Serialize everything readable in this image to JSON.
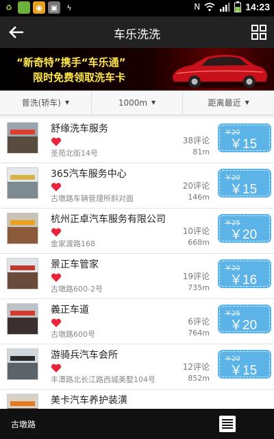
{
  "status_bar": {
    "time": "14:23",
    "icons": [
      "recycle-icon",
      "app-icon",
      "weibo-icon",
      "image-icon",
      "usb-icon",
      "nfc-icon",
      "wifi-icon",
      "signal-icon",
      "battery-icon"
    ],
    "battery_level": 0.55
  },
  "header": {
    "title": "车乐洗洗",
    "back_icon": "arrow-left-icon",
    "grid_icon": "grid-icon"
  },
  "banner": {
    "line1": "“新奇特”携手“车乐通”",
    "line2": "限时免费领取洗车卡",
    "text_color": "#ffe94a"
  },
  "filters": [
    {
      "label": "普洗(轿车)"
    },
    {
      "label": "1000m"
    },
    {
      "label": "距离最近"
    }
  ],
  "shops": [
    {
      "name": "舒缘洗车服务",
      "address": "圣苑北街14号",
      "reviews": "38评论",
      "distance": "81m",
      "orig_price": "￥20",
      "price": "￥15"
    },
    {
      "name": "365汽车服务中心",
      "address": "古墩路车辆管理所斜对面",
      "reviews": "20评论",
      "distance": "146m",
      "orig_price": "￥20",
      "price": "￥15"
    },
    {
      "name": "杭州正卓汽车服务有限公司",
      "address": "金家渡路168",
      "reviews": "10评论",
      "distance": "668m",
      "orig_price": "￥25",
      "price": "￥20"
    },
    {
      "name": "景正车管家",
      "address": "古墩路600-2号",
      "reviews": "19评论",
      "distance": "735m",
      "orig_price": "￥20",
      "price": "￥16"
    },
    {
      "name": "義正车道",
      "address": "古墩路600号",
      "reviews": "6评论",
      "distance": "764m",
      "orig_price": "￥25",
      "price": "￥20"
    },
    {
      "name": "游骑兵汽车会所",
      "address": "丰潭路北长江路西城美墅104号",
      "reviews": "12评论",
      "distance": "852m",
      "orig_price": "￥20",
      "price": "￥15"
    },
    {
      "name": "美卡汽车养护装潢",
      "address": "",
      "reviews": "",
      "distance": "",
      "orig_price": "",
      "price": ""
    }
  ],
  "bottom_bar": {
    "location": "古墩路",
    "menu_icon": "list-menu-icon"
  },
  "colors": {
    "coupon": "#5bb3e8",
    "heart": "#e8253a",
    "header_bg": "#222222"
  }
}
